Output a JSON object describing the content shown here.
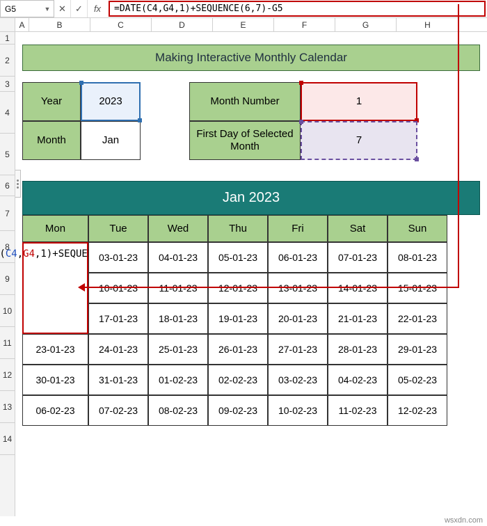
{
  "formula_bar": {
    "name_box": "G5",
    "formula": "=DATE(C4,G4,1)+SEQUENCE(6,7)-G5"
  },
  "columns": [
    "A",
    "B",
    "C",
    "D",
    "E",
    "F",
    "G",
    "H"
  ],
  "rows": {
    "1": 18,
    "2": 46,
    "3": 22,
    "4": 60,
    "5": 60,
    "6": 30,
    "7": 50,
    "8": 46,
    "9": 46,
    "10": 46,
    "11": 46,
    "12": 46,
    "13": 46,
    "14": 46
  },
  "title": "Making Interactive Monthly Calendar",
  "params": {
    "year_label": "Year",
    "year_value": "2023",
    "month_label": "Month",
    "month_value": "Jan",
    "month_num_label": "Month Number",
    "month_num_value": "1",
    "first_day_label": "First Day of Selected Month",
    "first_day_value": "7"
  },
  "calendar": {
    "title": "Jan 2023",
    "days": [
      "Mon",
      "Tue",
      "Wed",
      "Thu",
      "Fri",
      "Sat",
      "Sun"
    ],
    "formula_tokens": [
      {
        "t": "=DATE(",
        "c": "black"
      },
      {
        "t": "C4",
        "c": "blue"
      },
      {
        "t": ",",
        "c": "black"
      },
      {
        "t": "G4",
        "c": "red"
      },
      {
        "t": ",1)+",
        "c": "black"
      },
      {
        "t": "SEQUENC",
        "c": "black"
      },
      {
        "t": "E(6,7)-",
        "c": "black"
      },
      {
        "t": "G5",
        "c": "purple"
      }
    ],
    "rows": [
      [
        "",
        "03-01-23",
        "04-01-23",
        "05-01-23",
        "06-01-23",
        "07-01-23",
        "08-01-23"
      ],
      [
        "",
        "10-01-23",
        "11-01-23",
        "12-01-23",
        "13-01-23",
        "14-01-23",
        "15-01-23"
      ],
      [
        "",
        "17-01-23",
        "18-01-23",
        "19-01-23",
        "20-01-23",
        "21-01-23",
        "22-01-23"
      ],
      [
        "23-01-23",
        "24-01-23",
        "25-01-23",
        "26-01-23",
        "27-01-23",
        "28-01-23",
        "29-01-23"
      ],
      [
        "30-01-23",
        "31-01-23",
        "01-02-23",
        "02-02-23",
        "03-02-23",
        "04-02-23",
        "05-02-23"
      ],
      [
        "06-02-23",
        "07-02-23",
        "08-02-23",
        "09-02-23",
        "10-02-23",
        "11-02-23",
        "12-02-23"
      ]
    ]
  },
  "watermark": "wsxdn.com"
}
